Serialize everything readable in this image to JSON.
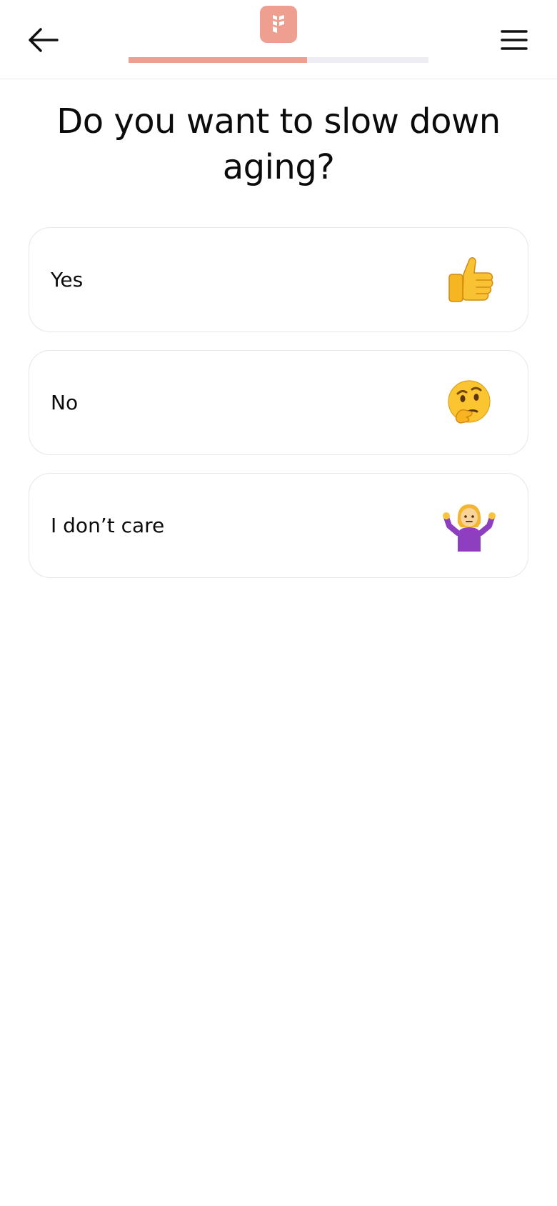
{
  "header": {
    "back_icon": "arrow-left-icon",
    "menu_icon": "hamburger-menu-icon",
    "logo_icon": "brand-leaf-logo-icon",
    "logo_color": "#ee9f90",
    "progress_fraction": 0.595,
    "progress_color": "#eda092",
    "progress_track_color": "#ededf3"
  },
  "question": {
    "title": "Do you want to slow down aging?"
  },
  "options": [
    {
      "label": "Yes",
      "icon": "thumbs-up-emoji-icon"
    },
    {
      "label": "No",
      "icon": "thinking-face-emoji-icon"
    },
    {
      "label": "I don’t care",
      "icon": "person-shrugging-emoji-icon"
    }
  ]
}
